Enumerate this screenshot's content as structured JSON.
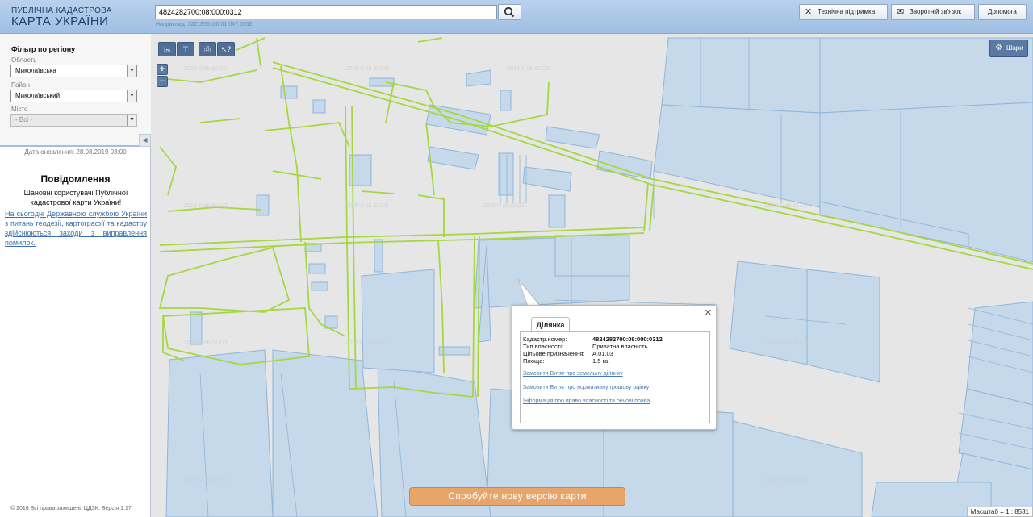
{
  "header": {
    "logo_line1": "ПУБЛІЧНА КАДАСТРОВА",
    "logo_line2": "КАРТА УКРАЇНИ",
    "search_value": "4824282700:08:000:0312",
    "search_hint": "Наприклад: 3221855100:01:047:0052",
    "buttons": {
      "support": "Технічна підтримка",
      "feedback": "Зворотній зв'язок",
      "help": "Допомога"
    }
  },
  "sidebar": {
    "filter_title": "Фільтр по регіону",
    "oblast_label": "Область",
    "oblast_value": "Миколаївська",
    "rayon_label": "Район",
    "rayon_value": "Миколаївський",
    "city_label": "Місто",
    "city_value": "- Всі -",
    "update_date": "Дата оновлення: 28.08.2019 03:00",
    "message_title": "Повідомлення",
    "message_intro": "Шановні користувачі Публічної кадастрової карти України!",
    "message_link": "На сьогодні Державною службою України з питань геодезії, картографії та кадастру здійснюються заходи з виправлення помилок.",
    "copyright": "© 2016 Всі права захищені. ЦДЗК. Версія 1.17"
  },
  "map": {
    "layers_label": "Шари",
    "zoom_in": "+",
    "zoom_out": "−",
    "watermark": "2018 © ob.SLCO",
    "new_version_label": "Спробуйте нову версію карти",
    "scale_label": "Масштаб = 1 : 8531"
  },
  "popup": {
    "tab_label": "Ділянка",
    "rows": [
      {
        "label": "Кадастр.номер:",
        "value": "4824282700:08:000:0312"
      },
      {
        "label": "Тип власності:",
        "value": "Приватна власність"
      },
      {
        "label": "Цільове призначення:",
        "value": "А.01.03"
      },
      {
        "label": "Площа:",
        "value": "1.5 га"
      }
    ],
    "links": [
      "Замовити Витяг про земельну ділянку",
      "Замовити Витяг про нормативну грошову оцінку",
      "Інформація про право власності та речові права"
    ]
  },
  "colors": {
    "parcel_fill": "#c5d9ea",
    "parcel_stroke": "#8fb5d9",
    "road_green": "#a6d640",
    "header_blue": "#9fbfe3",
    "new_version_orange": "#e8a56a"
  }
}
